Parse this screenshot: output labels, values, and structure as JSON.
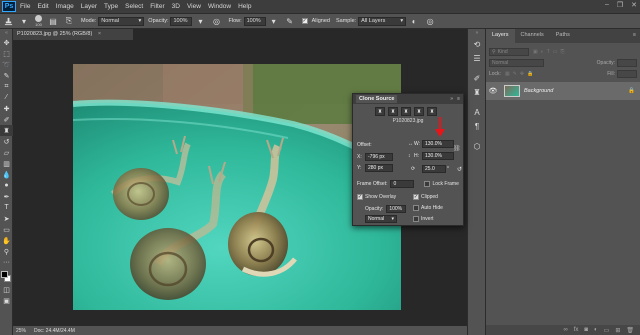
{
  "app": {
    "logo": "Ps"
  },
  "menu": [
    "File",
    "Edit",
    "Image",
    "Layer",
    "Type",
    "Select",
    "Filter",
    "3D",
    "View",
    "Window",
    "Help"
  ],
  "window_controls": [
    "–",
    "❐",
    "✕"
  ],
  "options_bar": {
    "brush_size": "100",
    "mode_label": "Mode:",
    "mode_value": "Normal",
    "opacity_label": "Opacity:",
    "opacity_value": "100%",
    "flow_label": "Flow:",
    "flow_value": "100%",
    "aligned_label": "Aligned",
    "sample_label": "Sample:",
    "sample_value": "All Layers"
  },
  "document": {
    "tab_title": "P1020823.jpg @ 25% (RGB/8)",
    "tab_close": "×"
  },
  "status": {
    "zoom": "25%",
    "doc_info": "Doc: 24.4M/24.4M"
  },
  "clone_source": {
    "title": "Clone Source",
    "file_name": "P1020823.jpg",
    "offset_label": "Offset:",
    "x_label": "X:",
    "x_value": "-796 px",
    "y_label": "Y:",
    "y_value": "280 px",
    "w_label": "W:",
    "w_value": "130.0%",
    "h_label": "H:",
    "h_value": "130.0%",
    "angle_value": "25.0",
    "angle_unit": "°",
    "frame_offset_label": "Frame Offset:",
    "frame_offset_value": "0",
    "lock_frame_label": "Lock Frame",
    "show_overlay_label": "Show Overlay",
    "clipped_label": "Clipped",
    "opacity_label": "Opacity:",
    "opacity_value": "100%",
    "auto_hide_label": "Auto Hide",
    "blend_value": "Normal",
    "invert_label": "Invert",
    "collapse_glyph": "»",
    "menu_glyph": "≡"
  },
  "layers_panel": {
    "tabs": [
      "Layers",
      "Channels",
      "Paths"
    ],
    "filter_placeholder": "Kind",
    "blend_mode": "Normal",
    "opacity_label": "Opacity:",
    "lock_label": "Lock:",
    "fill_label": "Fill:",
    "layer_name": "Background"
  },
  "colors": {
    "arrow": "#e8141a",
    "accent": "#31a8ff",
    "bowl": "#2fb89a"
  }
}
